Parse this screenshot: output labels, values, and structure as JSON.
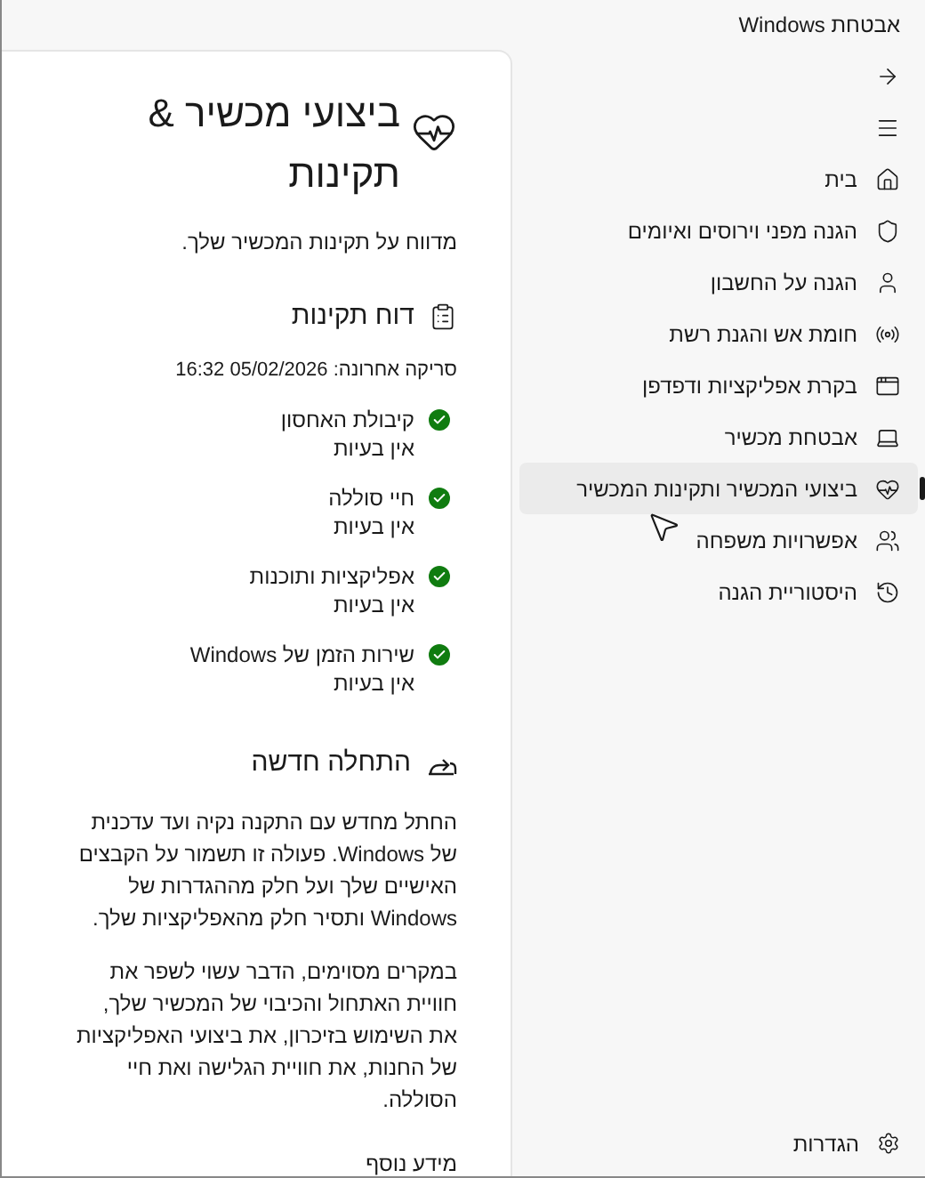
{
  "window": {
    "title": "אבטחת Windows"
  },
  "sidebar": {
    "items": [
      {
        "kind": "back",
        "selected": false
      },
      {
        "kind": "menu",
        "selected": false
      },
      {
        "kind": "home",
        "label": "בית",
        "selected": false
      },
      {
        "kind": "shield",
        "label": "הגנה מפני וירוסים ואיומים",
        "selected": false
      },
      {
        "kind": "account",
        "label": "הגנה על החשבון",
        "selected": false
      },
      {
        "kind": "network",
        "label": "חומת אש והגנת רשת",
        "selected": false
      },
      {
        "kind": "app",
        "label": "בקרת אפליקציות ודפדפן",
        "selected": false
      },
      {
        "kind": "device",
        "label": "אבטחת מכשיר",
        "selected": false
      },
      {
        "kind": "health",
        "label": "ביצועי המכשיר ותקינות המכשיר",
        "selected": true
      },
      {
        "kind": "family",
        "label": "אפשרויות משפחה",
        "selected": false
      },
      {
        "kind": "history",
        "label": "היסטוריית הגנה",
        "selected": false
      }
    ],
    "settings": "הגדרות"
  },
  "page": {
    "title": "ביצועי מכשיר & תקינות",
    "subtitle": "מדווח על תקינות המכשיר שלך.",
    "health_report": {
      "heading": "דוח תקינות",
      "last_scan": "סריקה אחרונה: 05/02/2026 16:32",
      "items": [
        {
          "name": "קיבולת האחסון",
          "status": "אין בעיות",
          "ok": true
        },
        {
          "name": "חיי סוללה",
          "status": "אין בעיות",
          "ok": true
        },
        {
          "name": "אפליקציות ותוכנות",
          "status": "אין בעיות",
          "ok": true
        },
        {
          "name": "שירות הזמן של Windows",
          "status": "אין בעיות",
          "ok": true
        }
      ]
    },
    "fresh_start": {
      "heading": "התחלה חדשה",
      "paragraphs": [
        "החתל מחדש עם התקנה נקיה ועד עדכנית של Windows. פעולה זו תשמור על הקבצים האישיים שלך ועל חלק מההגדרות של Windows ותסיר חלק מהאפליקציות שלך.",
        "במקרים מסוימים, הדבר עשוי לשפר את חוויית האתחול והכיבוי של המכשיר שלך, את השימוש בזיכרון, את ביצועי האפליקציות של החנות, את חוויית הגלישה ואת חיי הסוללה."
      ],
      "link": "מידע נוסף"
    }
  }
}
